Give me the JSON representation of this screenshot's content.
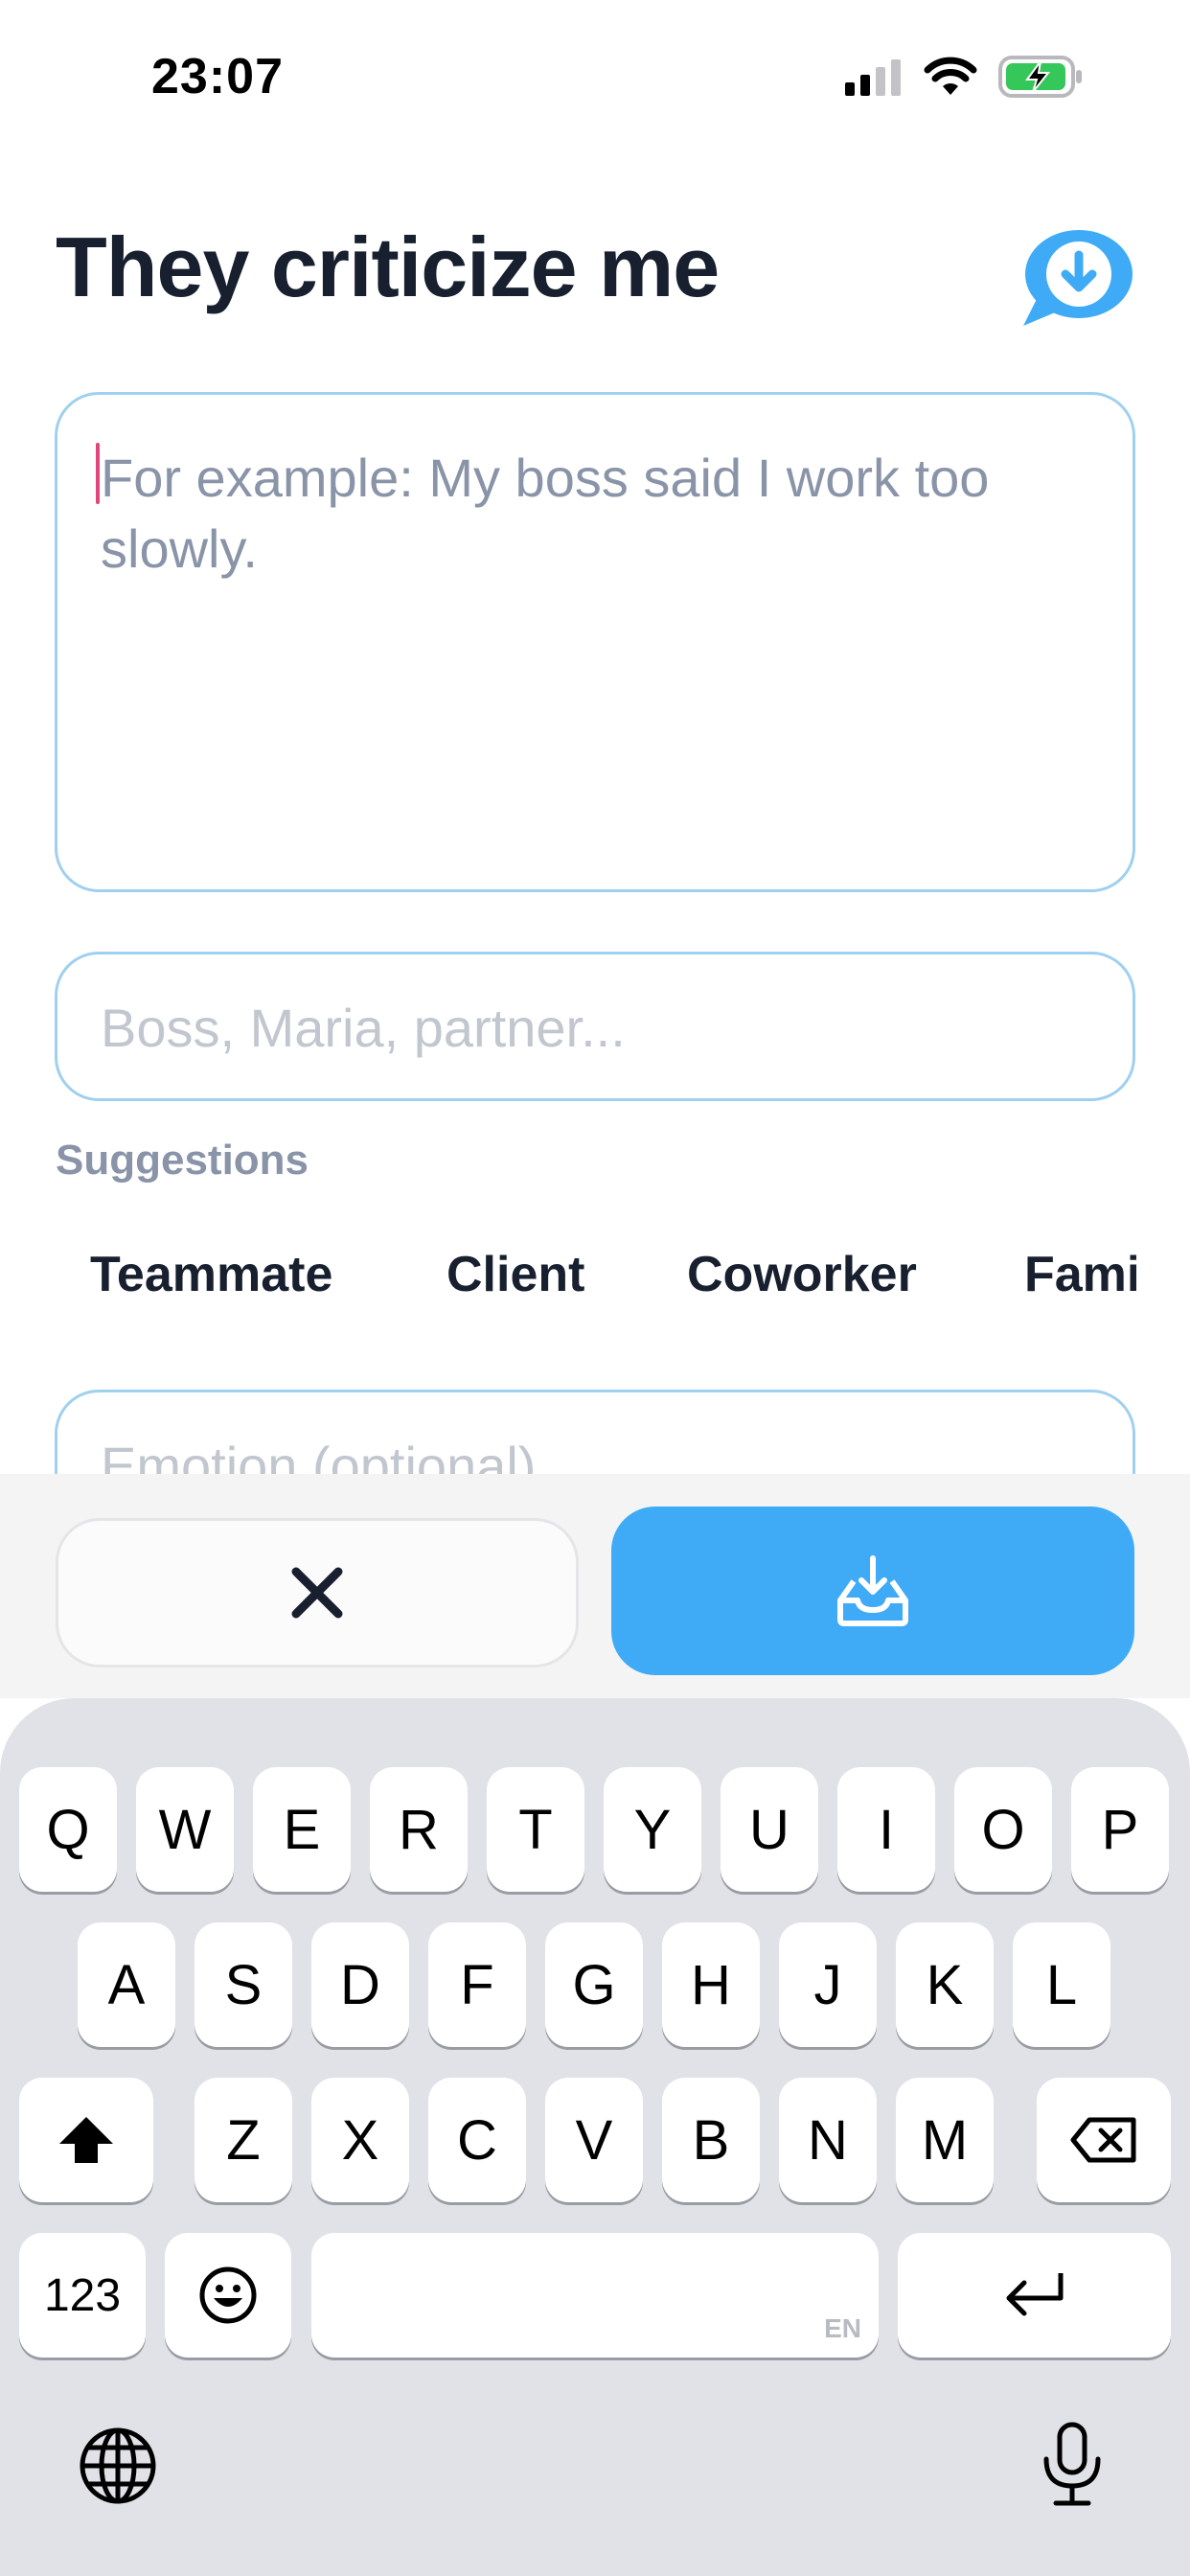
{
  "status_bar": {
    "time": "23:07"
  },
  "header": {
    "title": "They criticize me",
    "history_icon": "chat-download-icon"
  },
  "form": {
    "criticism_placeholder": "For example: My boss said I work too slowly.",
    "who_placeholder": "Boss, Maria, partner...",
    "suggestions_label": "Suggestions",
    "suggestions": [
      "Teammate",
      "Client",
      "Coworker",
      "Family"
    ],
    "emotion_placeholder": "Emotion (optional)"
  },
  "actions": {
    "cancel_icon": "close-icon",
    "save_icon": "inbox-download-icon"
  },
  "keyboard": {
    "row1": [
      "Q",
      "W",
      "E",
      "R",
      "T",
      "Y",
      "U",
      "I",
      "O",
      "P"
    ],
    "row2": [
      "A",
      "S",
      "D",
      "F",
      "G",
      "H",
      "J",
      "K",
      "L"
    ],
    "row3": [
      "Z",
      "X",
      "C",
      "V",
      "B",
      "N",
      "M"
    ],
    "numbers_label": "123",
    "space_language": "EN"
  },
  "colors": {
    "accent": "#3fabf6",
    "field_border": "#9fd0ef",
    "title": "#18202f",
    "muted": "#8a94a8",
    "caret": "#e0467a"
  }
}
